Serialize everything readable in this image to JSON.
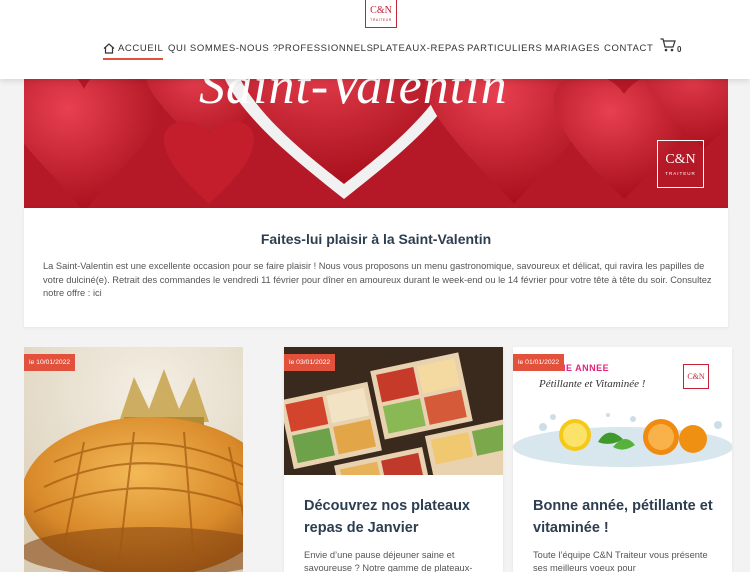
{
  "header": {
    "logo": {
      "main": "C&N",
      "sub": "TRAITEUR"
    },
    "nav": [
      {
        "label": "ACCUEIL",
        "name": "nav-accueil",
        "active": true,
        "icon": "home-icon"
      },
      {
        "label": "QUI SOMMES-NOUS ?",
        "name": "nav-qui-sommes-nous"
      },
      {
        "label": "PROFESSIONNELS",
        "name": "nav-professionnels"
      },
      {
        "label": "PLATEAUX-REPAS",
        "name": "nav-plateaux-repas"
      },
      {
        "label": "PARTICULIERS",
        "name": "nav-particuliers"
      },
      {
        "label": "MARIAGES",
        "name": "nav-mariages"
      },
      {
        "label": "CONTACT",
        "name": "nav-contact"
      }
    ],
    "cart": {
      "icon": "cart-icon",
      "count": "0"
    }
  },
  "hero": {
    "title": "Saint-Valentin",
    "logo": {
      "main": "C&N",
      "sub": "TRAITEUR"
    }
  },
  "feature": {
    "title": "Faites-lui plaisir à la Saint-Valentin",
    "text": "La Saint-Valentin est une excellente occasion pour se faire plaisir ! Nous vous proposons un menu gastronomique, savoureux et délicat, qui ravira les papilles de votre dulciné(e). Retrait des commandes le vendredi 11 février pour dîner en amoureux durant le week-end ou le 14 février pour votre tête à tête du soir. Consultez notre offre : ici"
  },
  "cards": [
    {
      "date": "le 10/01/2022",
      "title": "",
      "text": ""
    },
    {
      "date": "le 03/01/2022",
      "title": "Découvrez nos plateaux repas de Janvier",
      "text": "Envie d’une pause déjeuner saine et savoureuse ? Notre gamme de plateaux-"
    },
    {
      "date": "le 01/01/2022",
      "title": "Bonne année, pétillante et vitaminée !",
      "text": "Toute l’équipe C&N Traiteur vous présente ses meilleurs voeux pour",
      "image_caption_1": "NE ANNEE",
      "image_caption_2": "Pétillante et Vitaminée !",
      "image_logo": "C&N"
    }
  ],
  "colors": {
    "accent": "#e2513c",
    "brand": "#c2243a",
    "heading": "#2c3e50"
  }
}
